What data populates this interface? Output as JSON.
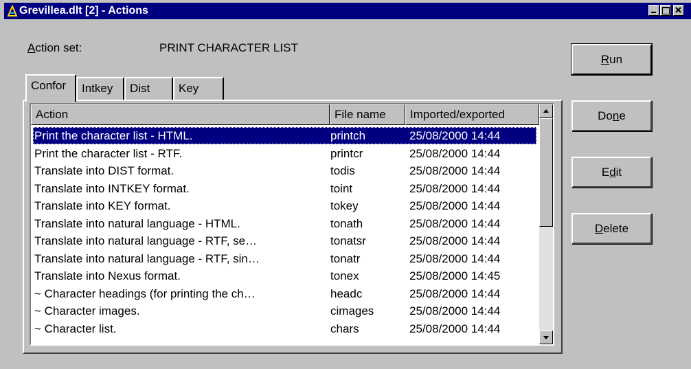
{
  "window": {
    "title": "Grevillea.dlt [2] - Actions"
  },
  "action_set": {
    "label": "Action set:",
    "value": "PRINT CHARACTER LIST"
  },
  "tabs": [
    {
      "label": "Confor"
    },
    {
      "label": "Intkey"
    },
    {
      "label": "Dist"
    },
    {
      "label": "Key"
    }
  ],
  "columns": {
    "action": "Action",
    "file": "File name",
    "date": "Imported/exported"
  },
  "rows": [
    {
      "action": "Print the character list - HTML.",
      "file": "printch",
      "date": "25/08/2000 14:44"
    },
    {
      "action": "Print the character list - RTF.",
      "file": "printcr",
      "date": "25/08/2000 14:44"
    },
    {
      "action": "Translate into DIST format.",
      "file": "todis",
      "date": "25/08/2000 14:44"
    },
    {
      "action": "Translate into INTKEY format.",
      "file": "toint",
      "date": "25/08/2000 14:44"
    },
    {
      "action": "Translate into KEY format.",
      "file": "tokey",
      "date": "25/08/2000 14:44"
    },
    {
      "action": "Translate into natural language - HTML.",
      "file": "tonath",
      "date": "25/08/2000 14:44"
    },
    {
      "action": "Translate into natural language - RTF, se…",
      "file": "tonatsr",
      "date": "25/08/2000 14:44"
    },
    {
      "action": "Translate into natural language - RTF, sin…",
      "file": "tonatr",
      "date": "25/08/2000 14:44"
    },
    {
      "action": "Translate into Nexus format.",
      "file": "tonex",
      "date": "25/08/2000 14:45"
    },
    {
      "action": "~ Character headings (for printing the ch…",
      "file": "headc",
      "date": "25/08/2000 14:44"
    },
    {
      "action": "~ Character images.",
      "file": "cimages",
      "date": "25/08/2000 14:44"
    },
    {
      "action": "~ Character list.",
      "file": "chars",
      "date": "25/08/2000 14:44"
    }
  ],
  "buttons": {
    "run": {
      "pre": "",
      "ul": "R",
      "post": "un"
    },
    "done": {
      "pre": "Do",
      "ul": "n",
      "post": "e"
    },
    "edit": {
      "pre": "E",
      "ul": "d",
      "post": "it"
    },
    "delete": {
      "pre": "",
      "ul": "D",
      "post": "elete"
    }
  }
}
